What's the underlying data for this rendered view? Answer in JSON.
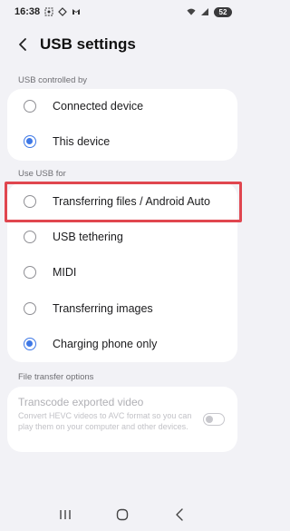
{
  "status_bar": {
    "time": "16:38",
    "battery": "52",
    "icons": [
      "screenshot-icon",
      "sync-icon",
      "gmail-icon",
      "wifi-icon",
      "signal-icon"
    ]
  },
  "header": {
    "title": "USB settings",
    "back_icon": "back-arrow-icon"
  },
  "usb_controlled_by": {
    "label": "USB controlled by",
    "options": [
      {
        "label": "Connected device",
        "checked": false
      },
      {
        "label": "This device",
        "checked": true
      }
    ]
  },
  "use_usb_for": {
    "label": "Use USB for",
    "options": [
      {
        "label": "Transferring files / Android Auto",
        "checked": false,
        "highlighted": true
      },
      {
        "label": "USB tethering",
        "checked": false
      },
      {
        "label": "MIDI",
        "checked": false
      },
      {
        "label": "Transferring images",
        "checked": false
      },
      {
        "label": "Charging phone only",
        "checked": true
      }
    ]
  },
  "file_transfer_options": {
    "label": "File transfer options",
    "item": {
      "title": "Transcode exported video",
      "description": "Convert HEVC videos to AVC format so you can play them on your computer and other devices.",
      "enabled": false,
      "toggle_on": false
    }
  },
  "nav_bar": {
    "recents_icon": "recents-icon",
    "home_icon": "home-icon",
    "back_icon": "back-nav-icon"
  },
  "colors": {
    "accent": "#3e78e6",
    "highlight": "#e0464f",
    "background": "#f2f2f6"
  }
}
